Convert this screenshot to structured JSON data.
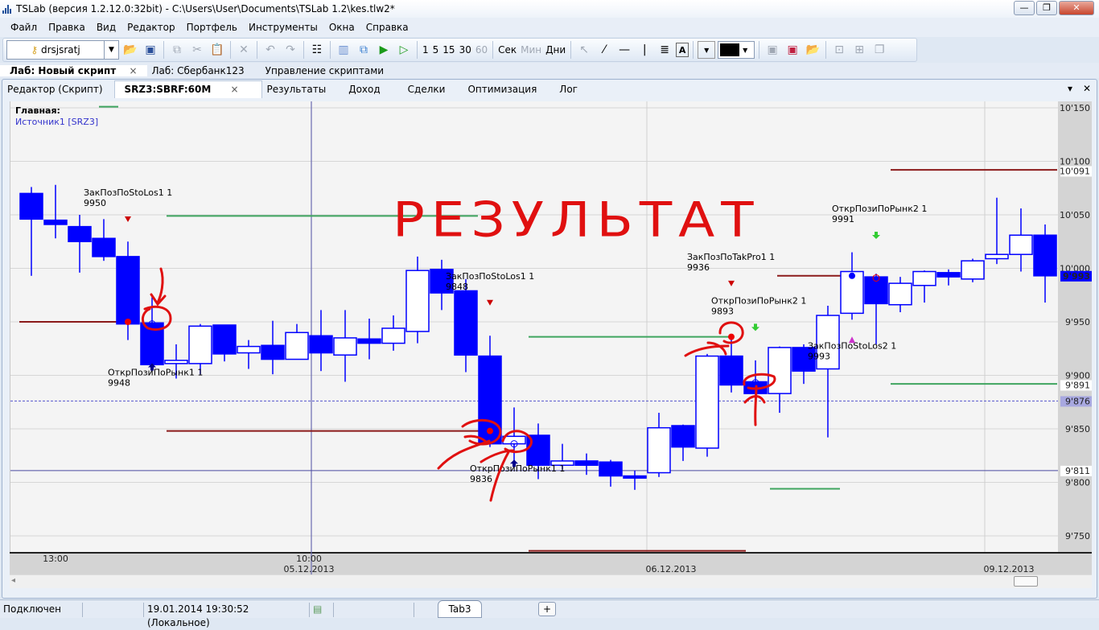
{
  "window": {
    "title": "TSLab (версия 1.2.12.0:32bit) - C:\\Users\\User\\Documents\\TSLab 1.2\\kes.tlw2*",
    "minimize": "—",
    "maximize": "❐",
    "close": "✕"
  },
  "menu": [
    "Файл",
    "Правка",
    "Вид",
    "Редактор",
    "Портфель",
    "Инструменты",
    "Окна",
    "Справка"
  ],
  "toolbar": {
    "account": "drsjsratj",
    "intervals": [
      "1",
      "5",
      "15",
      "30",
      "60"
    ],
    "units": [
      "Сек",
      "Мин",
      "Дни"
    ]
  },
  "lab_tabs": [
    {
      "label": "Лаб: Новый скрипт",
      "close": "×"
    },
    {
      "label": "Лаб: Сбербанк123"
    },
    {
      "label": "Управление скриптами"
    }
  ],
  "inner_tabs": [
    {
      "label": "Редактор (Скрипт)"
    },
    {
      "label": "SRZ3:SBRF:60M",
      "close": "×"
    },
    {
      "label": "Результаты"
    },
    {
      "label": "Доход"
    },
    {
      "label": "Сделки"
    },
    {
      "label": "Оптимизация"
    },
    {
      "label": "Лог"
    }
  ],
  "pane_controls": {
    "menu": "▾",
    "close": "✕"
  },
  "chart_header": {
    "pane": "Главная:",
    "source": "Источник1 [SRZ3]"
  },
  "handwriting": "РЕЗУЛЬТАТ",
  "colors": {
    "candle": "#0000ff",
    "stop": "#8b1a1a",
    "target": "#3fa55f",
    "cursor": "#4a4aa0"
  },
  "chart_data": {
    "type": "candlestick",
    "ylim": [
      9730,
      10160
    ],
    "yticks": [
      "10'150",
      "10'100",
      "10'050",
      "10'000",
      "9'950",
      "9'900",
      "9'850",
      "9'800",
      "9'750"
    ],
    "ytick_values": [
      10150,
      10100,
      10050,
      10000,
      9950,
      9900,
      9850,
      9800,
      9750
    ],
    "price_tags": [
      {
        "label": "10'091",
        "value": 10091,
        "color": "#8b1a1a",
        "bg": "#ffffff"
      },
      {
        "label": "9'993",
        "value": 9993,
        "color": "#ffffff",
        "bg": "#0000ff"
      },
      {
        "label": "9'891",
        "value": 9891,
        "color": "#3fa55f",
        "bg": "#ffffff"
      },
      {
        "label": "9'876",
        "value": 9876,
        "color": "#ffffff",
        "bg": "#a8a8e0"
      },
      {
        "label": "9'811",
        "value": 9811,
        "color": "#4a4aa0",
        "bg": "#ffffff"
      }
    ],
    "xticks": [
      {
        "label": "13:00",
        "bar": 1
      },
      {
        "label": "10:00",
        "bar": 11.5
      },
      {
        "label": "05.12.2013",
        "bar": 11.5
      },
      {
        "label": "06.12.2013",
        "bar": 26.5
      },
      {
        "label": "09.12.2013",
        "bar": 40.5
      }
    ],
    "day_separators": [
      25.5,
      39.5
    ],
    "cursor_bar": 11.6,
    "ohlc": [
      [
        10070,
        10076,
        9993,
        10046
      ],
      [
        10045,
        10078,
        10028,
        10041
      ],
      [
        10039,
        10050,
        9996,
        10025
      ],
      [
        10028,
        10046,
        10007,
        10011
      ],
      [
        10011,
        10025,
        9933,
        9948
      ],
      [
        9949,
        9973,
        9907,
        9910
      ],
      [
        9911,
        9929,
        9897,
        9914
      ],
      [
        9911,
        9948,
        9901,
        9946
      ],
      [
        9947,
        9947,
        9913,
        9920
      ],
      [
        9921,
        9933,
        9906,
        9927
      ],
      [
        9928,
        9951,
        9901,
        9915
      ],
      [
        9915,
        9948,
        9915,
        9940
      ],
      [
        9937,
        9961,
        9904,
        9921
      ],
      [
        9919,
        9961,
        9894,
        9935
      ],
      [
        9934,
        9953,
        9915,
        9930
      ],
      [
        9930,
        9956,
        9923,
        9944
      ],
      [
        9941,
        10011,
        9930,
        9998
      ],
      [
        9999,
        10008,
        9961,
        9977
      ],
      [
        9979,
        9990,
        9903,
        9919
      ],
      [
        9918,
        9937,
        9833,
        9836
      ],
      [
        9836,
        9870,
        9815,
        9843
      ],
      [
        9844,
        9855,
        9803,
        9816
      ],
      [
        9816,
        9836,
        9812,
        9820
      ],
      [
        9820,
        9827,
        9807,
        9816
      ],
      [
        9819,
        9821,
        9796,
        9806
      ],
      [
        9806,
        9811,
        9793,
        9804
      ],
      [
        9809,
        9865,
        9805,
        9851
      ],
      [
        9853,
        9854,
        9820,
        9833
      ],
      [
        9832,
        9920,
        9824,
        9918
      ],
      [
        9918,
        9935,
        9884,
        9891
      ],
      [
        9894,
        9914,
        9873,
        9883
      ],
      [
        9883,
        9927,
        9865,
        9926
      ],
      [
        9926,
        9929,
        9892,
        9904
      ],
      [
        9906,
        9965,
        9842,
        9956
      ],
      [
        9958,
        10015,
        9952,
        9997
      ],
      [
        9992,
        9995,
        9929,
        9967
      ],
      [
        9966,
        9992,
        9959,
        9986
      ],
      [
        9984,
        9998,
        9968,
        9997
      ],
      [
        9996,
        9999,
        9984,
        9992
      ],
      [
        9990,
        10009,
        9987,
        10007
      ],
      [
        10009,
        10066,
        10004,
        10013
      ],
      [
        10013,
        10056,
        9997,
        10031
      ],
      [
        10031,
        10041,
        9968,
        9993
      ]
    ],
    "levels": [
      {
        "kind": "stop",
        "value": 9950,
        "from": -0.5,
        "to": 4
      },
      {
        "kind": "target",
        "value": 10049,
        "from": 5.6,
        "to": 18.5
      },
      {
        "kind": "target",
        "value": 10151,
        "from": 2.8,
        "to": 3.6
      },
      {
        "kind": "stop",
        "value": 9848,
        "from": 5.6,
        "to": 18.7
      },
      {
        "kind": "target",
        "value": 9936,
        "from": 20.6,
        "to": 28.9
      },
      {
        "kind": "stop",
        "value": 9993,
        "from": 30.9,
        "to": 34.1
      },
      {
        "kind": "stop",
        "value": 10092,
        "from": 35.6,
        "to": 42.5
      },
      {
        "kind": "target",
        "value": 9892,
        "from": 35.6,
        "to": 42.5
      },
      {
        "kind": "target",
        "value": 9794,
        "from": 30.6,
        "to": 33.5
      },
      {
        "kind": "stop",
        "value": 9736,
        "from": 20.6,
        "to": 29.6
      }
    ],
    "hlines": [
      {
        "value": 9876,
        "style": "dashed",
        "color": "#5555cc"
      },
      {
        "value": 9811,
        "style": "solid",
        "color": "#4a4aa0"
      }
    ],
    "signals": [
      {
        "bar": 4,
        "text": "ЗакПозПоStoLos1 1",
        "price": "9950",
        "label_value": 10068,
        "side": "above",
        "marker": "down",
        "marker_color": "#cc0000",
        "fill_value": 9950,
        "fill": "filled-red"
      },
      {
        "bar": 5,
        "text": "ОткрПозиПоРынк1 1",
        "price": "9948",
        "label_value": 9900,
        "side": "below",
        "marker": "up",
        "marker_color": "#00008b",
        "fill_value": 9948,
        "fill": "hollow-blue"
      },
      {
        "bar": 19,
        "text": "ЗакПозПоStoLos1 1",
        "price": "9848",
        "label_value": 9990,
        "side": "above",
        "marker": "down",
        "marker_color": "#cc0000",
        "fill_value": 9848,
        "fill": "filled-red"
      },
      {
        "bar": 20,
        "text": "ОткрПозиПоРынк1 1",
        "price": "9836",
        "label_value": 9810,
        "side": "below",
        "marker": "up",
        "marker_color": "#00008b",
        "fill_value": 9836,
        "fill": "hollow-blue"
      },
      {
        "bar": 29,
        "text": "ЗакПозПоTakPro1 1",
        "price": "9936",
        "label_value": 10008,
        "side": "above",
        "marker": "down",
        "marker_color": "#cc0000",
        "fill_value": 9936,
        "fill": "filled-red"
      },
      {
        "bar": 30,
        "text": "ОткрПозиПоРынк2 1",
        "price": "9893",
        "label_value": 9967,
        "side": "above",
        "marker": "down-arrow",
        "marker_color": "#33cc33",
        "fill_value": 9893,
        "fill": "hollow-blue"
      },
      {
        "bar": 34,
        "text": "ЗакПозПоStoLos2 1",
        "price": "9993",
        "label_value": 9925,
        "side": "below",
        "marker": "up-tri",
        "marker_color": "#cc33cc",
        "fill_value": 9993,
        "fill": "filled-blue"
      },
      {
        "bar": 35,
        "text": "ОткрПозиПоРынк2 1",
        "price": "9991",
        "label_value": 10053,
        "side": "above",
        "marker": "down-arrow",
        "marker_color": "#33cc33",
        "fill_value": 9991,
        "fill": "hollow-red"
      }
    ]
  },
  "status": {
    "connection": "Подключен",
    "time": "19.01.2014 19:30:52 (Локальное)",
    "tab": "Tab3",
    "add": "+"
  }
}
